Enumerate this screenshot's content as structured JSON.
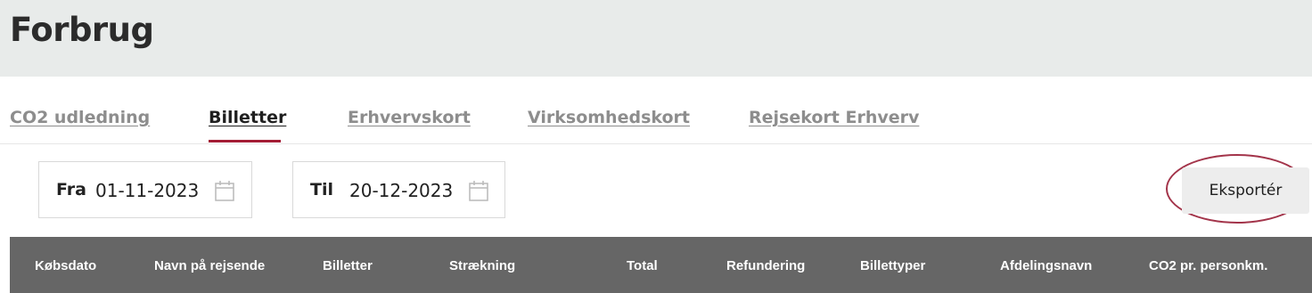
{
  "page": {
    "title": "Forbrug"
  },
  "tabs": [
    {
      "label": "CO2 udledning",
      "active": false
    },
    {
      "label": "Billetter",
      "active": true
    },
    {
      "label": "Erhvervskort",
      "active": false
    },
    {
      "label": "Virksomhedskort",
      "active": false
    },
    {
      "label": "Rejsekort Erhverv",
      "active": false
    }
  ],
  "filters": {
    "from": {
      "label": "Fra",
      "value": "01-11-2023",
      "icon": "calendar-icon"
    },
    "to": {
      "label": "Til",
      "value": "20-12-2023",
      "icon": "calendar-icon"
    }
  },
  "actions": {
    "export_label": "Eksportér"
  },
  "table": {
    "columns": [
      "Købsdato",
      "Navn på rejsende",
      "Billetter",
      "Strækning",
      "Total",
      "Refundering",
      "Billettyper",
      "Afdelingsnavn",
      "CO2 pr. personkm."
    ]
  },
  "colors": {
    "header_bg": "#e8ebea",
    "accent": "#a31d35",
    "table_header_bg": "#666666"
  }
}
